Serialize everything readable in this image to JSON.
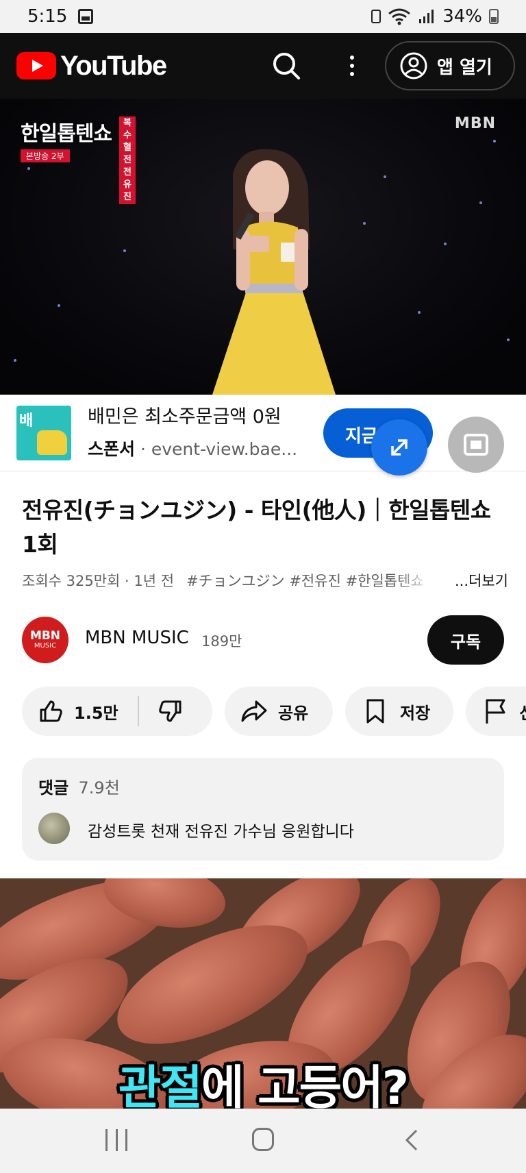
{
  "status_bar": {
    "time": "5:15",
    "battery": "34%"
  },
  "header": {
    "logo_text": "YouTube",
    "open_app_label": "앱 열기"
  },
  "video": {
    "show_title": "한일톱텐쇼",
    "show_tag": "복수혈전 전유진",
    "show_sub": "본방송 2부",
    "network": "MBN"
  },
  "ad": {
    "thumb_text": "배",
    "title": "배민은 최소주문금액 0원",
    "sponsor_label": "스폰서",
    "url": "event-view.bae...",
    "cta_label": "지금"
  },
  "title": "전유진(チョンユジン) - 타인(他人)｜한일톱텐쇼 1회",
  "meta": {
    "views_time": "조회수 325만회 · 1년 전",
    "hashtags": "#チョンユジン #전유진 #한일톱텐쇼",
    "more_label": "...더보기"
  },
  "channel": {
    "avatar_top": "MBN",
    "avatar_bottom": "MUSIC",
    "name": "MBN MUSIC",
    "subscribers": "189만",
    "subscribe_label": "구독"
  },
  "actions": {
    "like_count": "1.5만",
    "share_label": "공유",
    "save_label": "저장",
    "report_label": "신"
  },
  "comments": {
    "label": "댓글",
    "count": "7.9천",
    "top_comment": "감성트롯 천재 전유진 가수님 응원합니다"
  },
  "next_video": {
    "caption_highlight": "관절",
    "caption_rest": "에 고등어?"
  }
}
